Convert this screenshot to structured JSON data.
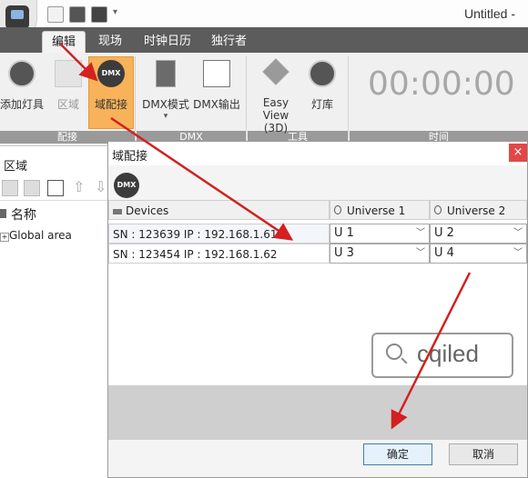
{
  "window": {
    "title": "Untitled -"
  },
  "tabs": [
    {
      "label": "编辑",
      "active": true
    },
    {
      "label": "现场"
    },
    {
      "label": "时钟日历"
    },
    {
      "label": "独行者"
    }
  ],
  "ribbon": {
    "groups": {
      "patch": "配接",
      "dmx": "DMX",
      "tools": "工具",
      "time": "时间"
    },
    "buttons": {
      "add_fixture": "添加灯具",
      "zone": "区域",
      "universe_patch": "域配接",
      "dmx_mode": "DMX模式",
      "dmx_output": "DMX输出",
      "easy_view": "Easy View",
      "easy_view_sub": "(3D)",
      "library": "灯库"
    },
    "timer": "00:00:00"
  },
  "left_panel": {
    "title": "区域",
    "column": "名称",
    "items": [
      "Global area"
    ]
  },
  "dialog": {
    "title": "域配接",
    "icon_label": "DMX",
    "columns": {
      "devices": "Devices",
      "u1": "Universe 1",
      "u2": "Universe 2"
    },
    "rows": [
      {
        "device": "SN : 123639   IP : 192.168.1.61",
        "u1": "U 1",
        "u2": "U 2"
      },
      {
        "device": "SN : 123454   IP : 192.168.1.62",
        "u1": "U 3",
        "u2": "U 4"
      }
    ],
    "ok": "确定",
    "cancel": "取消",
    "close": "×"
  },
  "watermark": {
    "text": "cqiled"
  },
  "colors": {
    "accent": "#f7b25a",
    "arrow": "#d32020",
    "tabstrip": "#5c5c5c"
  }
}
